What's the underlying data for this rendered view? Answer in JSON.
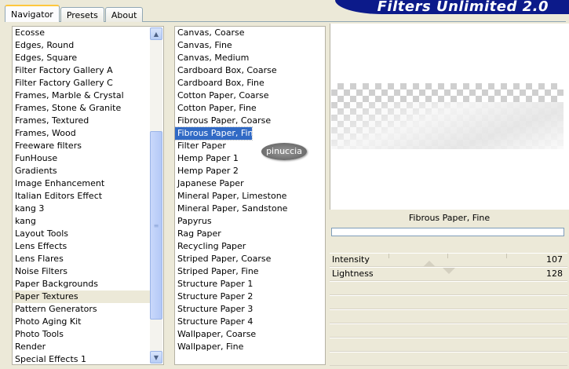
{
  "tabs": [
    "Navigator",
    "Presets",
    "About"
  ],
  "banner_title": "Filters Unlimited 2.0",
  "categories": [
    "Ecosse",
    "Edges, Round",
    "Edges, Square",
    "Filter Factory Gallery A",
    "Filter Factory Gallery C",
    "Frames, Marble & Crystal",
    "Frames, Stone & Granite",
    "Frames, Textured",
    "Frames, Wood",
    "Freeware filters",
    "FunHouse",
    "Gradients",
    "Image Enhancement",
    "Italian Editors Effect",
    "kang 3",
    "kang",
    "Layout Tools",
    "Lens Effects",
    "Lens Flares",
    "Noise Filters",
    "Paper Backgrounds",
    "Paper Textures",
    "Pattern Generators",
    "Photo Aging Kit",
    "Photo Tools",
    "Render",
    "Special Effects 1"
  ],
  "current_category_index": 21,
  "filters": [
    "Canvas, Coarse",
    "Canvas, Fine",
    "Canvas, Medium",
    "Cardboard Box, Coarse",
    "Cardboard Box, Fine",
    "Cotton Paper, Coarse",
    "Cotton Paper, Fine",
    "Fibrous Paper, Coarse",
    "Fibrous Paper, Fine",
    "Filter Paper",
    "Hemp Paper 1",
    "Hemp Paper 2",
    "Japanese Paper",
    "Mineral Paper, Limestone",
    "Mineral Paper, Sandstone",
    "Papyrus",
    "Rag Paper",
    "Recycling Paper",
    "Striped Paper, Coarse",
    "Striped Paper, Fine",
    "Structure Paper 1",
    "Structure Paper 2",
    "Structure Paper 3",
    "Structure Paper 4",
    "Wallpaper, Coarse",
    "Wallpaper, Fine"
  ],
  "selected_filter_index": 8,
  "watermark": "pinuccia",
  "preview_filter_name": "Fibrous Paper, Fine",
  "sliders": [
    {
      "label": "Intensity",
      "value": "107",
      "position": 107
    },
    {
      "label": "Lightness",
      "value": "128",
      "position": 128
    }
  ],
  "icons": {
    "scroll_up": "chevron-up-icon",
    "scroll_down": "chevron-down-icon",
    "thumb_grip": "grip-icon"
  },
  "colors": {
    "selection": "#316ac5",
    "banner": "#0c1a8a",
    "panel_bg": "#ece9d8"
  }
}
